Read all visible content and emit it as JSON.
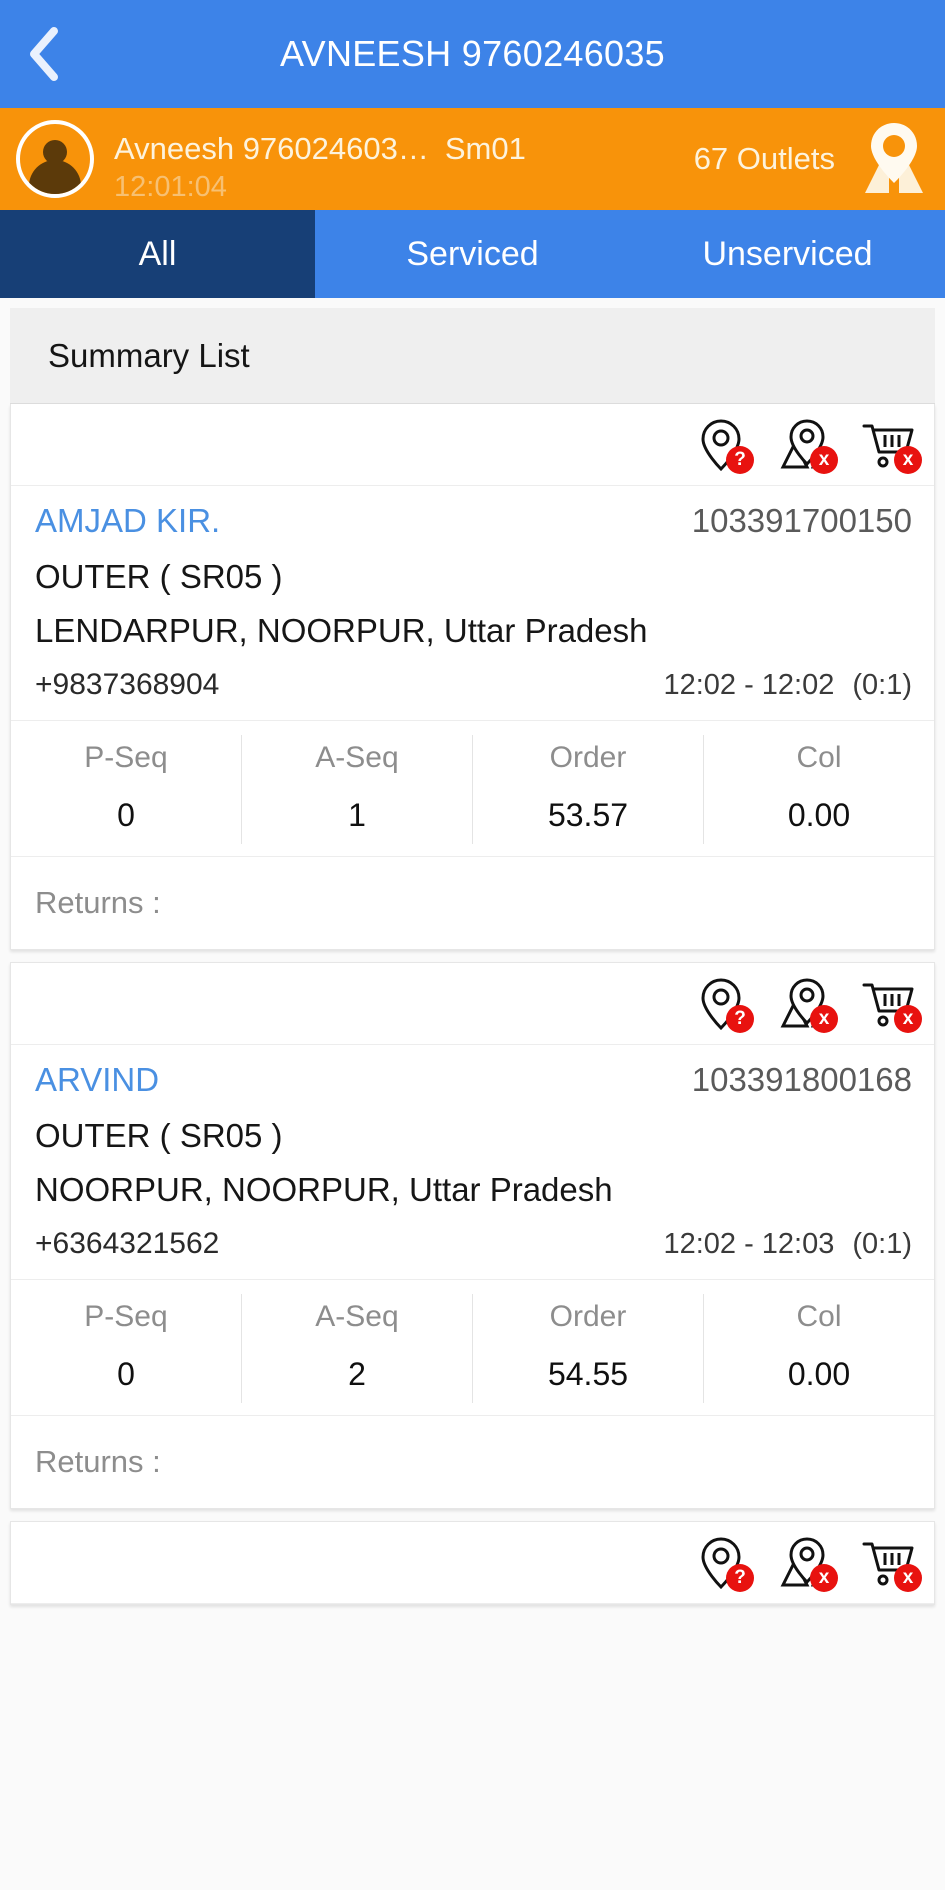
{
  "appbar": {
    "back_icon": "chevron-left-icon",
    "title": "AVNEESH 9760246035"
  },
  "user_strip": {
    "avatar_icon": "person-avatar-icon",
    "name": "Avneesh 976024603…",
    "code": "Sm01",
    "time": "12:01:04",
    "outlets": "67 Outlets",
    "map_icon": "map-pin-location-icon"
  },
  "tabs": [
    {
      "label": "All",
      "active": true
    },
    {
      "label": "Serviced",
      "active": false
    },
    {
      "label": "Unserviced",
      "active": false
    }
  ],
  "summary": {
    "header": "Summary List"
  },
  "status_icons": [
    {
      "name": "location-pin-question-icon",
      "badge": "?"
    },
    {
      "name": "map-pin-cross-icon",
      "badge": "x"
    },
    {
      "name": "shopping-cart-cross-icon",
      "badge": "x"
    }
  ],
  "stat_labels": [
    "P-Seq",
    "A-Seq",
    "Order",
    "Col"
  ],
  "returns_label": "Returns :",
  "outlets": [
    {
      "name": "AMJAD KIR.",
      "code": "103391700150",
      "route": "OUTER ( SR05 )",
      "address": "LENDARPUR, NOORPUR, Uttar Pradesh",
      "phone": "+9837368904",
      "time_range": "12:02 - 12:02",
      "duration": "(0:1)",
      "stats": [
        "0",
        "1",
        "53.57",
        "0.00"
      ]
    },
    {
      "name": "ARVIND",
      "code": "103391800168",
      "route": "OUTER ( SR05 )",
      "address": "NOORPUR, NOORPUR, Uttar Pradesh",
      "phone": "+6364321562",
      "time_range": "12:02 - 12:03",
      "duration": "(0:1)",
      "stats": [
        "0",
        "2",
        "54.55",
        "0.00"
      ]
    }
  ],
  "colors": {
    "appbar_blue": "#3d83e8",
    "strip_orange": "#f8930a",
    "tab_active_navy": "#173f76",
    "link_blue": "#4a90e2",
    "badge_red": "#e8120f"
  }
}
